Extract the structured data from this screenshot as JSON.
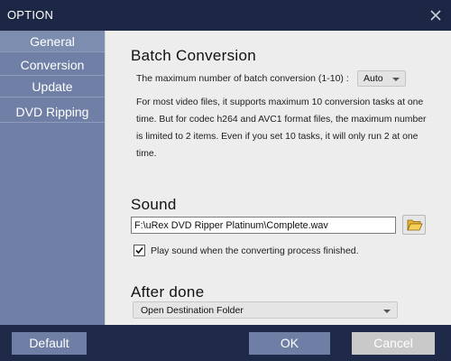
{
  "window": {
    "title": "OPTION",
    "close_icon": "close-icon"
  },
  "sidebar": {
    "items": [
      {
        "label": "General",
        "selected": true
      },
      {
        "label": "Conversion",
        "selected": false
      },
      {
        "label": "Update",
        "selected": false
      },
      {
        "label": "DVD Ripping",
        "selected": false
      }
    ]
  },
  "batch": {
    "heading": "Batch Conversion",
    "max_label": "The maximum number of batch conversion (1-10) :",
    "max_value": "Auto",
    "description": "For most video files, it supports maximum 10 conversion tasks at one time. But for codec h264 and AVC1 format files, the maximum number is limited to 2 items. Even if you set 10 tasks, it will only run 2 at one time."
  },
  "sound": {
    "heading": "Sound",
    "path": "F:\\uRex DVD Ripper Platinum\\Complete.wav",
    "browse_icon": "folder-open-icon",
    "play_checkbox_checked": true,
    "play_checkbox_label": "Play sound when the converting process finished."
  },
  "after_done": {
    "heading": "After done",
    "selected": "Open Destination Folder"
  },
  "footer": {
    "default_label": "Default",
    "ok_label": "OK",
    "cancel_label": "Cancel"
  },
  "colors": {
    "titlebar": "#1b2744",
    "sidebar": "#6f7fa5",
    "content_bg": "#ededed",
    "button_blue": "#6e7ea4",
    "button_gray": "#c9c9c9"
  }
}
